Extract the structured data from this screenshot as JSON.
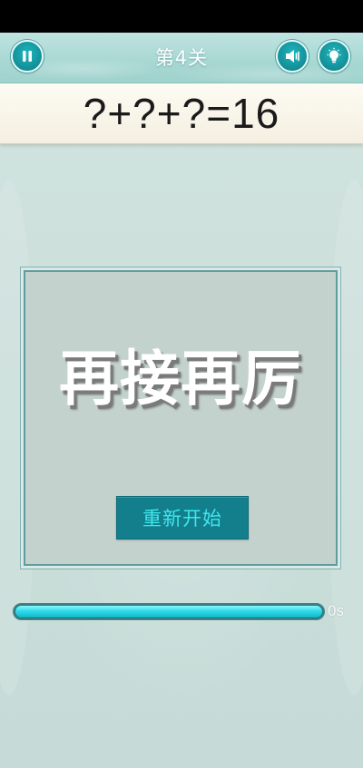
{
  "header": {
    "level_title": "第4关"
  },
  "puzzle": {
    "equation": "?+?+?=16"
  },
  "result_dialog": {
    "message": "再接再厉",
    "restart_label": "重新开始"
  },
  "timer": {
    "remaining_fraction": 1.0,
    "label": "0s"
  },
  "icons": {
    "pause": "pause-icon",
    "sound": "speaker-muted-icon",
    "hint": "lightbulb-icon"
  },
  "colors": {
    "accent": "#147f8c",
    "button_text": "#3fe7ee",
    "timer_fill": "#2fdbe9"
  }
}
